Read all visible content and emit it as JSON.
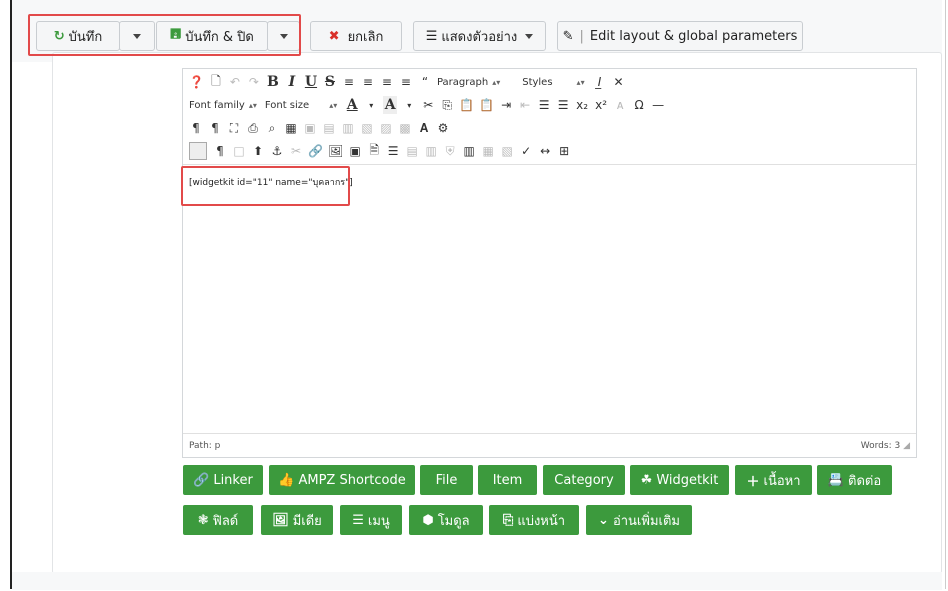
{
  "toolbar": {
    "save_label": "บันทึก",
    "save_close_label": "บันทึก & ปิด",
    "cancel_label": "ยกเลิก",
    "preview_label": "แสดงตัวอย่าง",
    "edit_layout_label": "Edit layout & global parameters"
  },
  "editor": {
    "paragraph_select": "Paragraph",
    "styles_select": "Styles",
    "font_family_select": "Font family",
    "font_size_select": "Font size",
    "content_text": "[widgetkit id=\"11\" name=\"บุคลากร\"]",
    "path_text": "Path: p",
    "words_text": "Words: 3"
  },
  "buttons_row1": [
    "Linker",
    "AMPZ Shortcode",
    "File",
    "Item",
    "Category",
    "Widgetkit",
    "เนื้อหา",
    "ติดต่อ"
  ],
  "buttons_row2": [
    "ฟิลด์",
    "มีเดีย",
    "เมนู",
    "โมดูล",
    "แบ่งหน้า",
    "อ่านเพิ่มเติม"
  ],
  "colors": {
    "green": "#3c9a3d",
    "highlight": "#e24a4a",
    "cancel_red": "#d9302a",
    "save_green": "#3c9a3d"
  }
}
